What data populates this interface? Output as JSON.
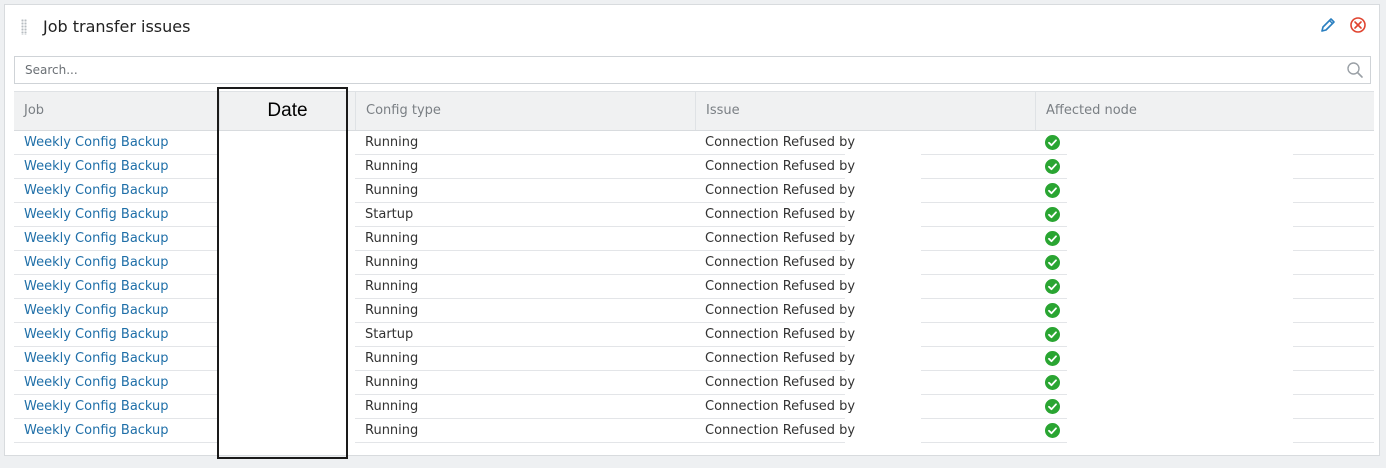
{
  "widget": {
    "title": "Job transfer issues",
    "icons": {
      "drag": "drag-handle-icon",
      "edit": "pencil-icon",
      "close": "close-circle-icon"
    }
  },
  "search": {
    "placeholder": "Search...",
    "value": "",
    "icon": "search-icon"
  },
  "table": {
    "columns": [
      "Job",
      "Date",
      "Config type",
      "Issue",
      "Affected node"
    ],
    "rows": [
      {
        "job": "Weekly Config Backup",
        "date": "",
        "config": "Running",
        "issue": "Connection Refused by",
        "node_status": "ok"
      },
      {
        "job": "Weekly Config Backup",
        "date": "",
        "config": "Running",
        "issue": "Connection Refused by",
        "node_status": "ok"
      },
      {
        "job": "Weekly Config Backup",
        "date": "",
        "config": "Running",
        "issue": "Connection Refused by",
        "node_status": "ok"
      },
      {
        "job": "Weekly Config Backup",
        "date": "",
        "config": "Startup",
        "issue": "Connection Refused by",
        "node_status": "ok"
      },
      {
        "job": "Weekly Config Backup",
        "date": "",
        "config": "Running",
        "issue": "Connection Refused by",
        "node_status": "ok"
      },
      {
        "job": "Weekly Config Backup",
        "date": "",
        "config": "Running",
        "issue": "Connection Refused by",
        "node_status": "ok"
      },
      {
        "job": "Weekly Config Backup",
        "date": "",
        "config": "Running",
        "issue": "Connection Refused by",
        "node_status": "ok"
      },
      {
        "job": "Weekly Config Backup",
        "date": "",
        "config": "Running",
        "issue": "Connection Refused by",
        "node_status": "ok"
      },
      {
        "job": "Weekly Config Backup",
        "date": "",
        "config": "Startup",
        "issue": "Connection Refused by",
        "node_status": "ok"
      },
      {
        "job": "Weekly Config Backup",
        "date": "",
        "config": "Running",
        "issue": "Connection Refused by",
        "node_status": "ok"
      },
      {
        "job": "Weekly Config Backup",
        "date": "",
        "config": "Running",
        "issue": "Connection Refused by",
        "node_status": "ok"
      },
      {
        "job": "Weekly Config Backup",
        "date": "",
        "config": "Running",
        "issue": "Connection Refused by",
        "node_status": "ok"
      },
      {
        "job": "Weekly Config Backup",
        "date": "",
        "config": "Running",
        "issue": "Connection Refused by",
        "node_status": "ok"
      }
    ]
  },
  "colors": {
    "link": "#1f6fa8",
    "ok_green": "#2aa532",
    "close_red": "#e0432f",
    "edit_blue": "#2a7fc0",
    "highlight_border": "#1a1a1a"
  }
}
